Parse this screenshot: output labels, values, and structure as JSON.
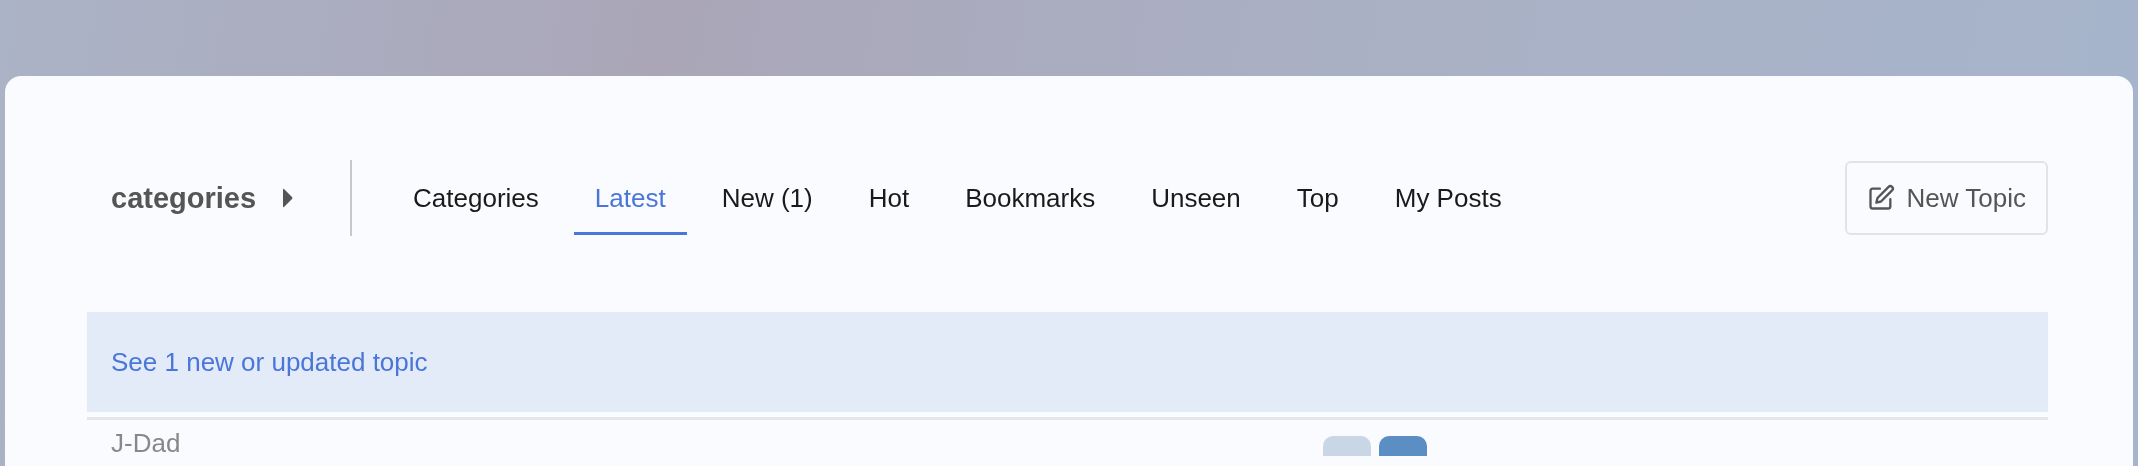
{
  "breadcrumb": {
    "label": "categories"
  },
  "tabs": [
    {
      "label": "Categories",
      "selected": false
    },
    {
      "label": "Latest",
      "selected": true
    },
    {
      "label": "New (1)",
      "selected": false
    },
    {
      "label": "Hot",
      "selected": false
    },
    {
      "label": "Bookmarks",
      "selected": false
    },
    {
      "label": "Unseen",
      "selected": false
    },
    {
      "label": "Top",
      "selected": false
    },
    {
      "label": "My Posts",
      "selected": false
    }
  ],
  "new_topic_button": {
    "label": "New Topic"
  },
  "banner": {
    "text": "See 1 new or updated topic"
  },
  "topics": [
    {
      "title": "J-Dad"
    }
  ]
}
